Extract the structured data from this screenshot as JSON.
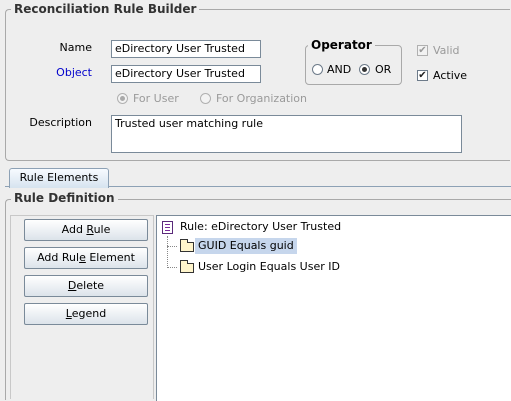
{
  "builder": {
    "title": "Reconciliation Rule Builder",
    "name_label": "Name",
    "name_value": "eDirectory User Trusted",
    "object_label": "Object",
    "object_value": "eDirectory User Trusted",
    "operator_label": "Operator",
    "and_label": "AND",
    "or_label": "OR",
    "operator_selected": "OR",
    "valid_label": "Valid",
    "valid_checked": true,
    "active_label": "Active",
    "active_checked": true,
    "for_user_label": "For User",
    "for_org_label": "For Organization",
    "description_label": "Description",
    "description_value": "Trusted user matching rule"
  },
  "tabs": [
    {
      "label": "Rule Elements",
      "active": true
    }
  ],
  "rule_definition": {
    "title": "Rule Definition",
    "buttons": {
      "add_rule_pre": "Add ",
      "add_rule_mn": "R",
      "add_rule_post": "ule",
      "add_element_pre": "Add Rul",
      "add_element_mn": "e",
      "add_element_post": " Element",
      "delete_pre": "",
      "delete_mn": "D",
      "delete_post": "elete",
      "legend_pre": "",
      "legend_mn": "L",
      "legend_post": "egend"
    },
    "tree": {
      "root_label": "Rule: eDirectory User Trusted",
      "children": [
        {
          "label": "GUID Equals guid",
          "selected": true
        },
        {
          "label": "User Login Equals User ID",
          "selected": false
        }
      ]
    }
  },
  "colors": {
    "object_label": "#0000cc",
    "selection": "#c6d6ec",
    "tab_border": "#8da1b5"
  }
}
